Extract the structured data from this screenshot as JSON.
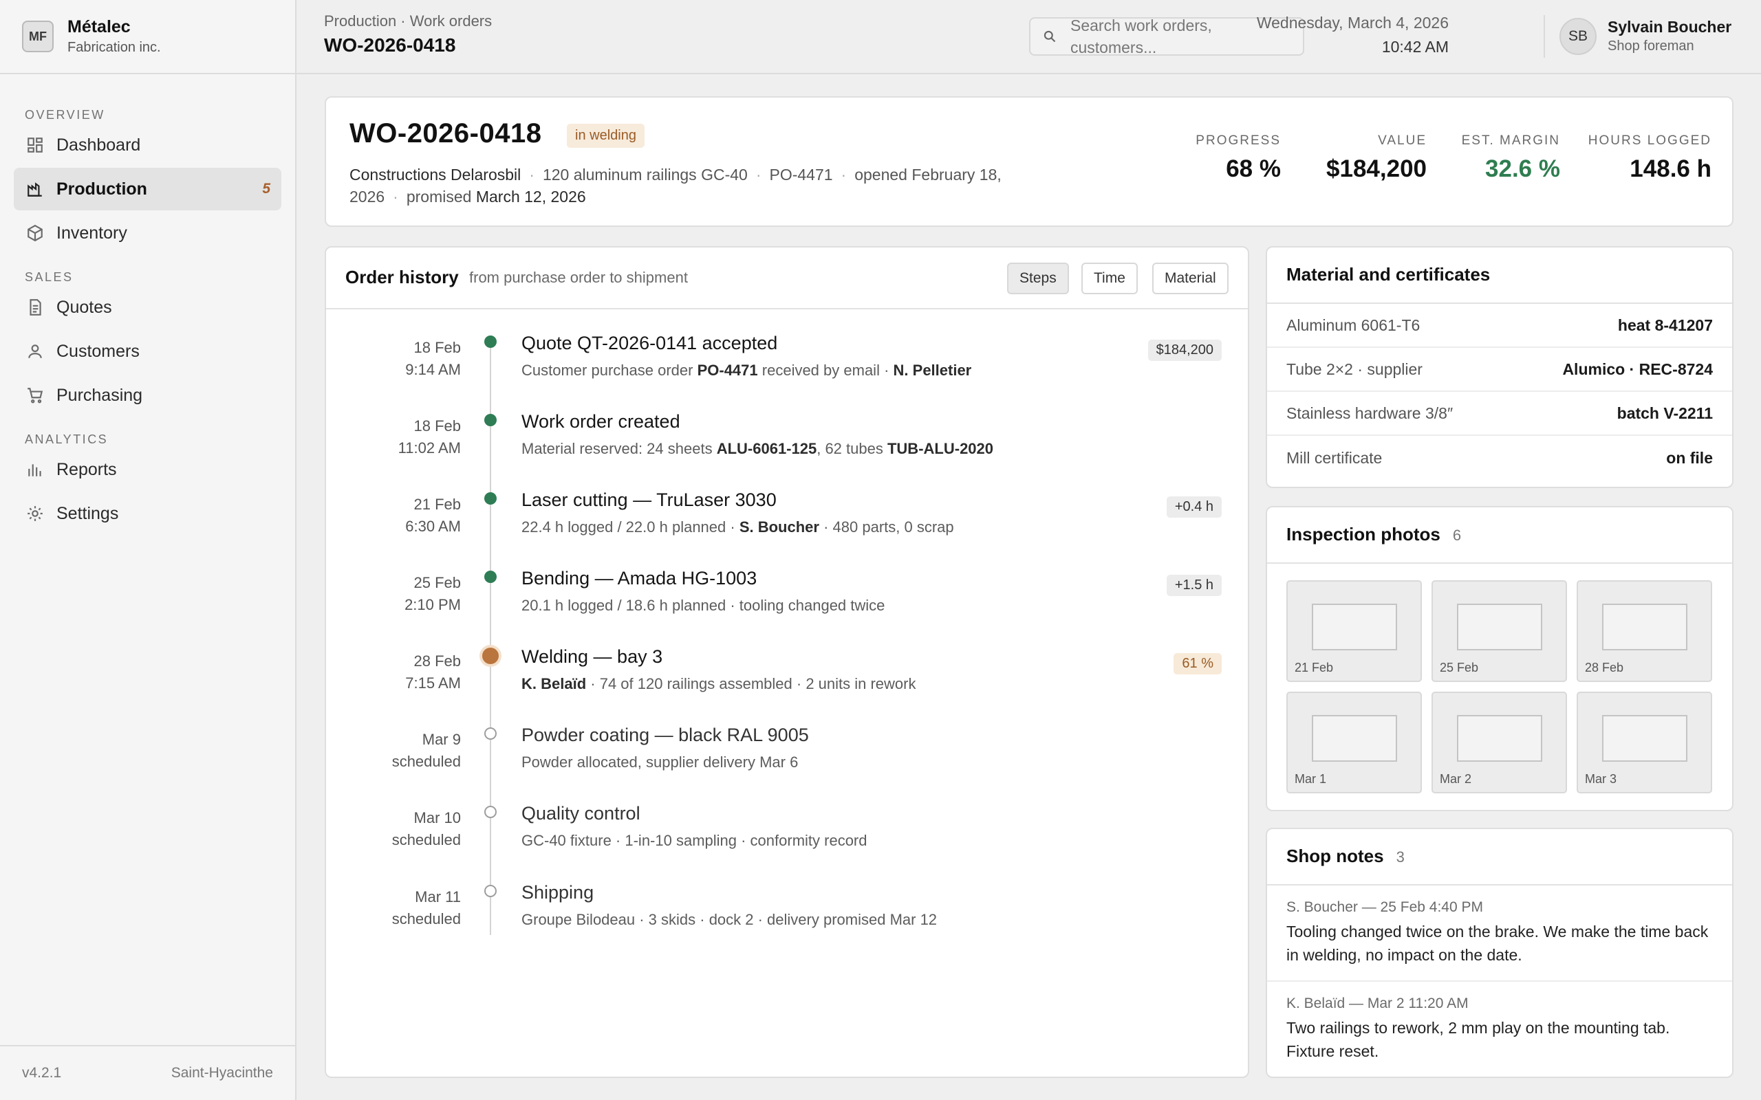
{
  "app": {
    "logo": "MF",
    "name": "Métalec",
    "subtitle": "Fabrication inc.",
    "version": "v4.2.1",
    "location": "Saint-Hyacinthe"
  },
  "nav": {
    "overview_label": "OVERVIEW",
    "sales_label": "SALES",
    "analytics_label": "ANALYTICS",
    "items": [
      {
        "label": "Dashboard",
        "icon": "dashboard-icon"
      },
      {
        "label": "Production",
        "icon": "production-icon",
        "badge": "5",
        "active": true
      },
      {
        "label": "Inventory",
        "icon": "box-icon"
      },
      {
        "label": "Quotes",
        "icon": "document-icon"
      },
      {
        "label": "Customers",
        "icon": "user-icon"
      },
      {
        "label": "Purchasing",
        "icon": "cart-icon"
      },
      {
        "label": "Reports",
        "icon": "bar-chart-icon"
      },
      {
        "label": "Settings",
        "icon": "gear-icon"
      }
    ]
  },
  "header": {
    "breadcrumb": "Production · Work orders",
    "title": "WO-2026-0418",
    "search_placeholder": "Search work orders, customers...",
    "date": "Wednesday, March 4, 2026",
    "time": "10:42 AM",
    "user_initials": "SB",
    "user_name": "Sylvain Boucher",
    "user_role": "Shop foreman"
  },
  "summary": {
    "title": "WO-2026-0418",
    "status": "in welding",
    "customer": "Constructions Delarosbil",
    "product": "120 aluminum railings GC-40",
    "po": "PO-4471",
    "opened_prefix": "opened",
    "opened": "February 18, 2026",
    "promised_prefix": "promised",
    "promised": "March 12, 2026",
    "kpis": [
      {
        "label": "PROGRESS",
        "value": "68 %"
      },
      {
        "label": "VALUE",
        "value": "$184,200"
      },
      {
        "label": "EST. MARGIN",
        "value": "32.6 %"
      },
      {
        "label": "HOURS LOGGED",
        "value": "148.6 h"
      }
    ]
  },
  "history": {
    "title": "Order history",
    "subtitle": "from purchase order to shipment",
    "views": [
      "Steps",
      "Time",
      "Material"
    ],
    "events": [
      {
        "date": "18 Feb",
        "time": "9:14 AM",
        "title": "Quote QT-2026-0141 accepted",
        "sub_pre": "Customer purchase order",
        "sub_b1": "PO-4471",
        "sub_mid": "received by email ·",
        "sub_b2": "N. Pelletier",
        "tag": "$184,200"
      },
      {
        "date": "18 Feb",
        "time": "11:02 AM",
        "title": "Work order created",
        "sub_pre": "Material reserved: 24 sheets",
        "sub_b1": "ALU-6061-125",
        "sub_mid": ", 62 tubes",
        "sub_b2": "TUB-ALU-2020"
      },
      {
        "date": "21 Feb",
        "time": "6:30 AM",
        "title": "Laser cutting — TruLaser 3030",
        "sub_pre": "22.4 h logged / 22.0 h planned ·",
        "sub_b1": "S. Boucher",
        "sub_mid": "· 480 parts, 0 scrap",
        "tag": "+0.4 h"
      },
      {
        "date": "25 Feb",
        "time": "2:10 PM",
        "title": "Bending — Amada HG-1003",
        "sub_pre": "20.1 h logged / 18.6 h planned · tooling changed twice",
        "tag": "+1.5 h"
      },
      {
        "date": "28 Feb",
        "time": "7:15 AM",
        "title": "Welding — bay 3",
        "sub_b1": "K. Belaïd",
        "sub_mid": "· 74 of 120 railings assembled · 2 units in rework",
        "tag": "61 %"
      },
      {
        "date": "Mar 9",
        "time": "scheduled",
        "title": "Powder coating — black RAL 9005",
        "sub_pre": "Powder allocated, supplier delivery Mar 6"
      },
      {
        "date": "Mar 10",
        "time": "scheduled",
        "title": "Quality control",
        "sub_pre": "GC-40 fixture · 1-in-10 sampling · conformity record"
      },
      {
        "date": "Mar 11",
        "time": "scheduled",
        "title": "Shipping",
        "sub_pre": "Groupe Bilodeau · 3 skids · dock 2 · delivery promised Mar 12"
      }
    ]
  },
  "materials": {
    "title": "Material and certificates",
    "rows": [
      {
        "label": "Aluminum 6061-T6",
        "value": "heat 8-41207"
      },
      {
        "label": "Tube 2×2 · supplier",
        "value": "Alumico · REC-8724"
      },
      {
        "label": "Stainless hardware 3/8″",
        "value": "batch V-2211"
      },
      {
        "label": "Mill certificate",
        "value": "on file"
      }
    ]
  },
  "photos": {
    "title": "Inspection photos",
    "count": "6",
    "items": [
      "21 Feb",
      "25 Feb",
      "28 Feb",
      "Mar 1",
      "Mar 2",
      "Mar 3"
    ]
  },
  "notes": {
    "title": "Shop notes",
    "count": "3",
    "items": [
      {
        "meta": "S. Boucher — 25 Feb 4:40 PM",
        "text": "Tooling changed twice on the brake. We make the time back in welding, no impact on the date."
      },
      {
        "meta": "K. Belaïd — Mar 2 11:20 AM",
        "text": "Two railings to rework, 2 mm play on the mounting tab. Fixture reset."
      }
    ]
  },
  "colors": {
    "accent_green": "#2f7d50",
    "status_warm": "#9a5b24",
    "status_bg": "#f7ebdc"
  }
}
